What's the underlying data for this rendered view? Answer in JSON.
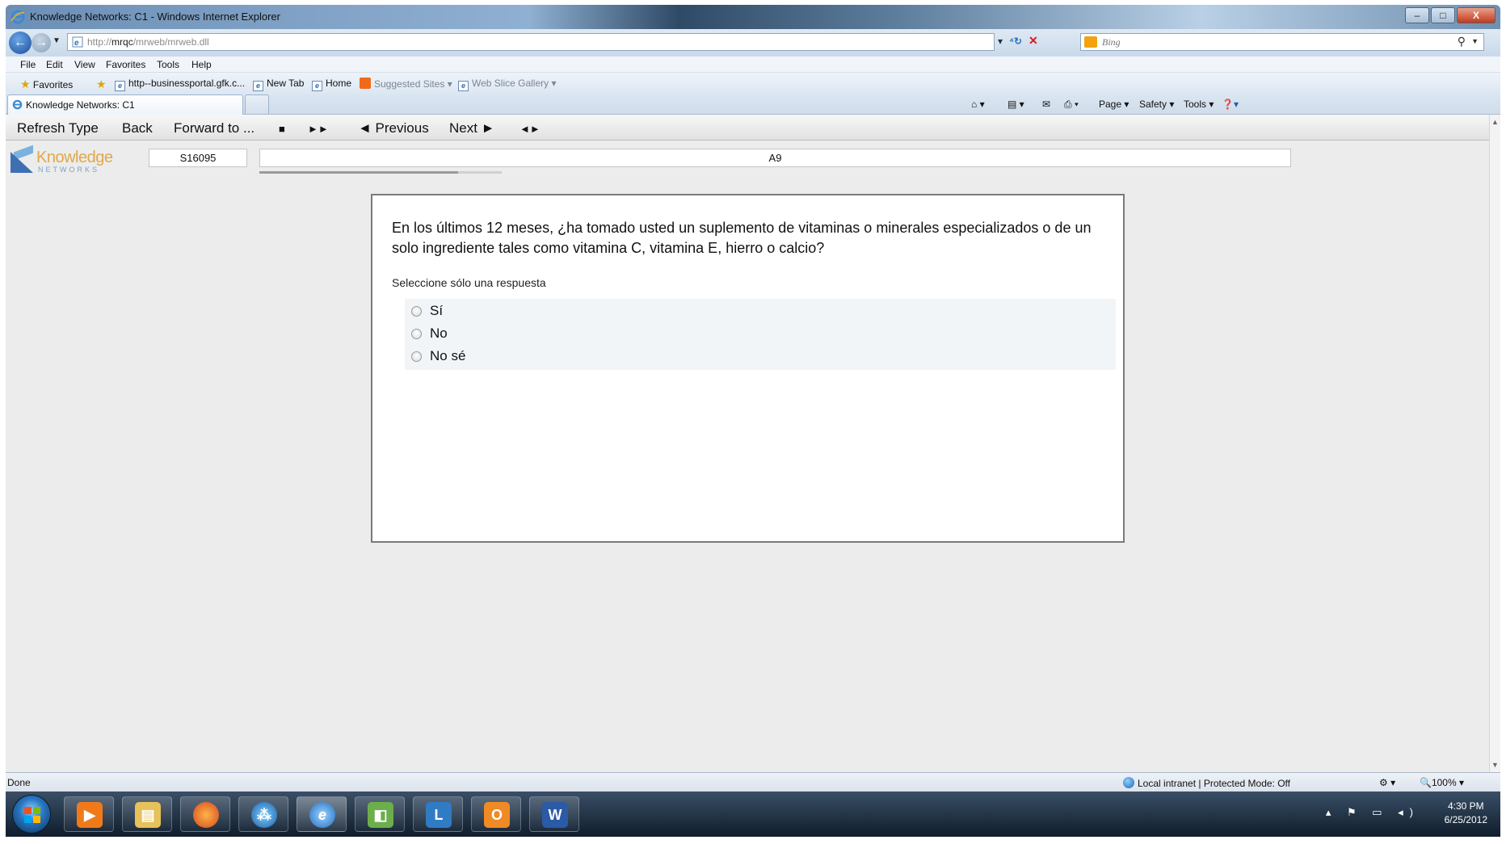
{
  "window": {
    "title": "Knowledge Networks: C1 - Windows Internet Explorer",
    "controls": {
      "minimize": "–",
      "maximize": "□",
      "close": "X"
    }
  },
  "address_bar": {
    "url_prefix": "http://",
    "url_host": "mrqc",
    "url_path": "/mrweb/mrweb.dll",
    "search_placeholder": "Bing"
  },
  "menu": [
    "File",
    "Edit",
    "View",
    "Favorites",
    "Tools",
    "Help"
  ],
  "favorites_bar": {
    "favorites_label": "Favorites",
    "items": [
      "http--businessportal.gfk.c...",
      "New Tab",
      "Home",
      "Suggested Sites ▾",
      "Web Slice Gallery ▾"
    ]
  },
  "tab": {
    "label": "Knowledge Networks: C1"
  },
  "command_bar": {
    "page": "Page ▾",
    "safety": "Safety ▾",
    "tools": "Tools ▾",
    "help": "❓▾"
  },
  "survey_toolbar": {
    "refresh_type": "Refresh Type",
    "back": "Back",
    "forward_to": "Forward to ...",
    "stop": "■",
    "fast_forward": "►►",
    "previous": "◄ Previous",
    "next": "Next ►",
    "prev_next": "◄►"
  },
  "header": {
    "logo_word": "Knowledge",
    "logo_sub": "NETWORKS",
    "respondent_id": "S16095",
    "question_code": "A9",
    "progress_fraction": 0.82
  },
  "question": {
    "text": "En los últimos 12 meses, ¿ha tomado usted un suplemento de vitaminas o minerales especializados o de un solo ingrediente tales como vitamina C, vitamina E, hierro o calcio?",
    "instruction": "Seleccione sólo una respuesta",
    "options": [
      "Sí",
      "No",
      "No sé"
    ]
  },
  "status_bar": {
    "left": "Done",
    "zone": "Local intranet | Protected Mode: Off",
    "zoom": "100%"
  },
  "taskbar": {
    "time": "4:30 PM",
    "date": "6/25/2012"
  },
  "colors": {
    "ie_blue": "#2c6fb8",
    "logo_gold": "#e0a84a",
    "logo_blue": "#3f6fb3",
    "content_bg": "#ececec"
  }
}
